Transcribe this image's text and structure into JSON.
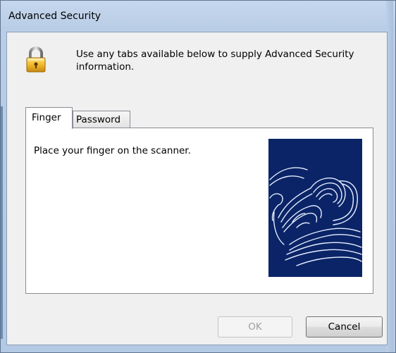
{
  "window": {
    "title": "Advanced Security"
  },
  "header": {
    "icon": "padlock-icon",
    "message": "Use any tabs available below to supply Advanced Security information."
  },
  "tabs": [
    {
      "label": "Finger",
      "selected": true
    },
    {
      "label": "Password",
      "selected": false
    }
  ],
  "finger_panel": {
    "instruction": "Place your finger on the scanner.",
    "image": "fingerprint-scanner-illustration"
  },
  "buttons": {
    "ok_label": "OK",
    "ok_enabled": false,
    "cancel_label": "Cancel"
  },
  "colors": {
    "scanner_background": "#0a2467",
    "frame": "#b9cde6"
  }
}
